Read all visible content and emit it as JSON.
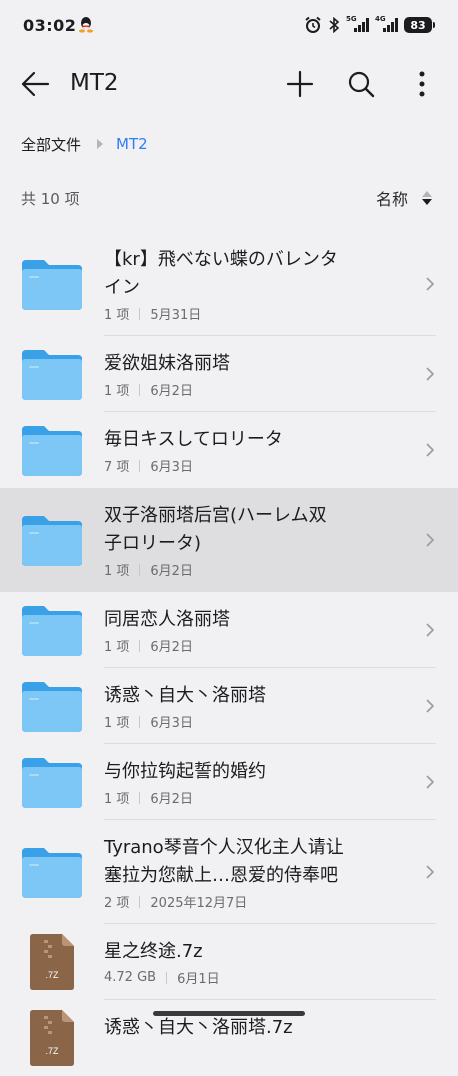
{
  "status": {
    "time": "03:02",
    "net1": "5G",
    "net2": "4G",
    "battery": "83"
  },
  "appbar": {
    "title": "MT2"
  },
  "breadcrumb": {
    "root": "全部文件",
    "current": "MT2"
  },
  "list_header": {
    "count": "共 10 项",
    "sort_label": "名称"
  },
  "items": [
    {
      "type": "folder",
      "name1": "【kr】飛べない蝶のバレンタ",
      "name2": "イン",
      "count": "1 项",
      "date": "5月31日"
    },
    {
      "type": "folder",
      "name1": "爱欲姐妹洛丽塔",
      "name2": "",
      "count": "1 项",
      "date": "6月2日"
    },
    {
      "type": "folder",
      "name1": "毎日キスしてロリータ",
      "name2": "",
      "count": "7 项",
      "date": "6月3日"
    },
    {
      "type": "folder",
      "name1": "双子洛丽塔后宫(ハーレム双",
      "name2": "子ロリータ)",
      "count": "1 项",
      "date": "6月2日",
      "selected": true
    },
    {
      "type": "folder",
      "name1": "同居恋人洛丽塔",
      "name2": "",
      "count": "1 项",
      "date": "6月2日"
    },
    {
      "type": "folder",
      "name1": "诱惑丶自大丶洛丽塔",
      "name2": "",
      "count": "1 项",
      "date": "6月3日"
    },
    {
      "type": "folder",
      "name1": "与你拉钩起誓的婚约",
      "name2": "",
      "count": "1 项",
      "date": "6月2日"
    },
    {
      "type": "folder",
      "name1": "Tyrano琴音个人汉化主人请让",
      "name2": "塞拉为您献上…恩爱的侍奉吧",
      "count": "2 项",
      "date": "2025年12月7日"
    },
    {
      "type": "archive",
      "name1": "星之终途.7z",
      "name2": "",
      "count": "4.72 GB",
      "date": "6月1日",
      "ext": ".7Z"
    },
    {
      "type": "archive",
      "name1": "诱惑丶自大丶洛丽塔.7z",
      "name2": "",
      "count": "",
      "date": "",
      "ext": ".7Z"
    }
  ],
  "colors": {
    "accent": "#2f7df6",
    "folder_light": "#7cc7f5",
    "folder_dark": "#3aa0e8",
    "archive": "#8a6547"
  }
}
